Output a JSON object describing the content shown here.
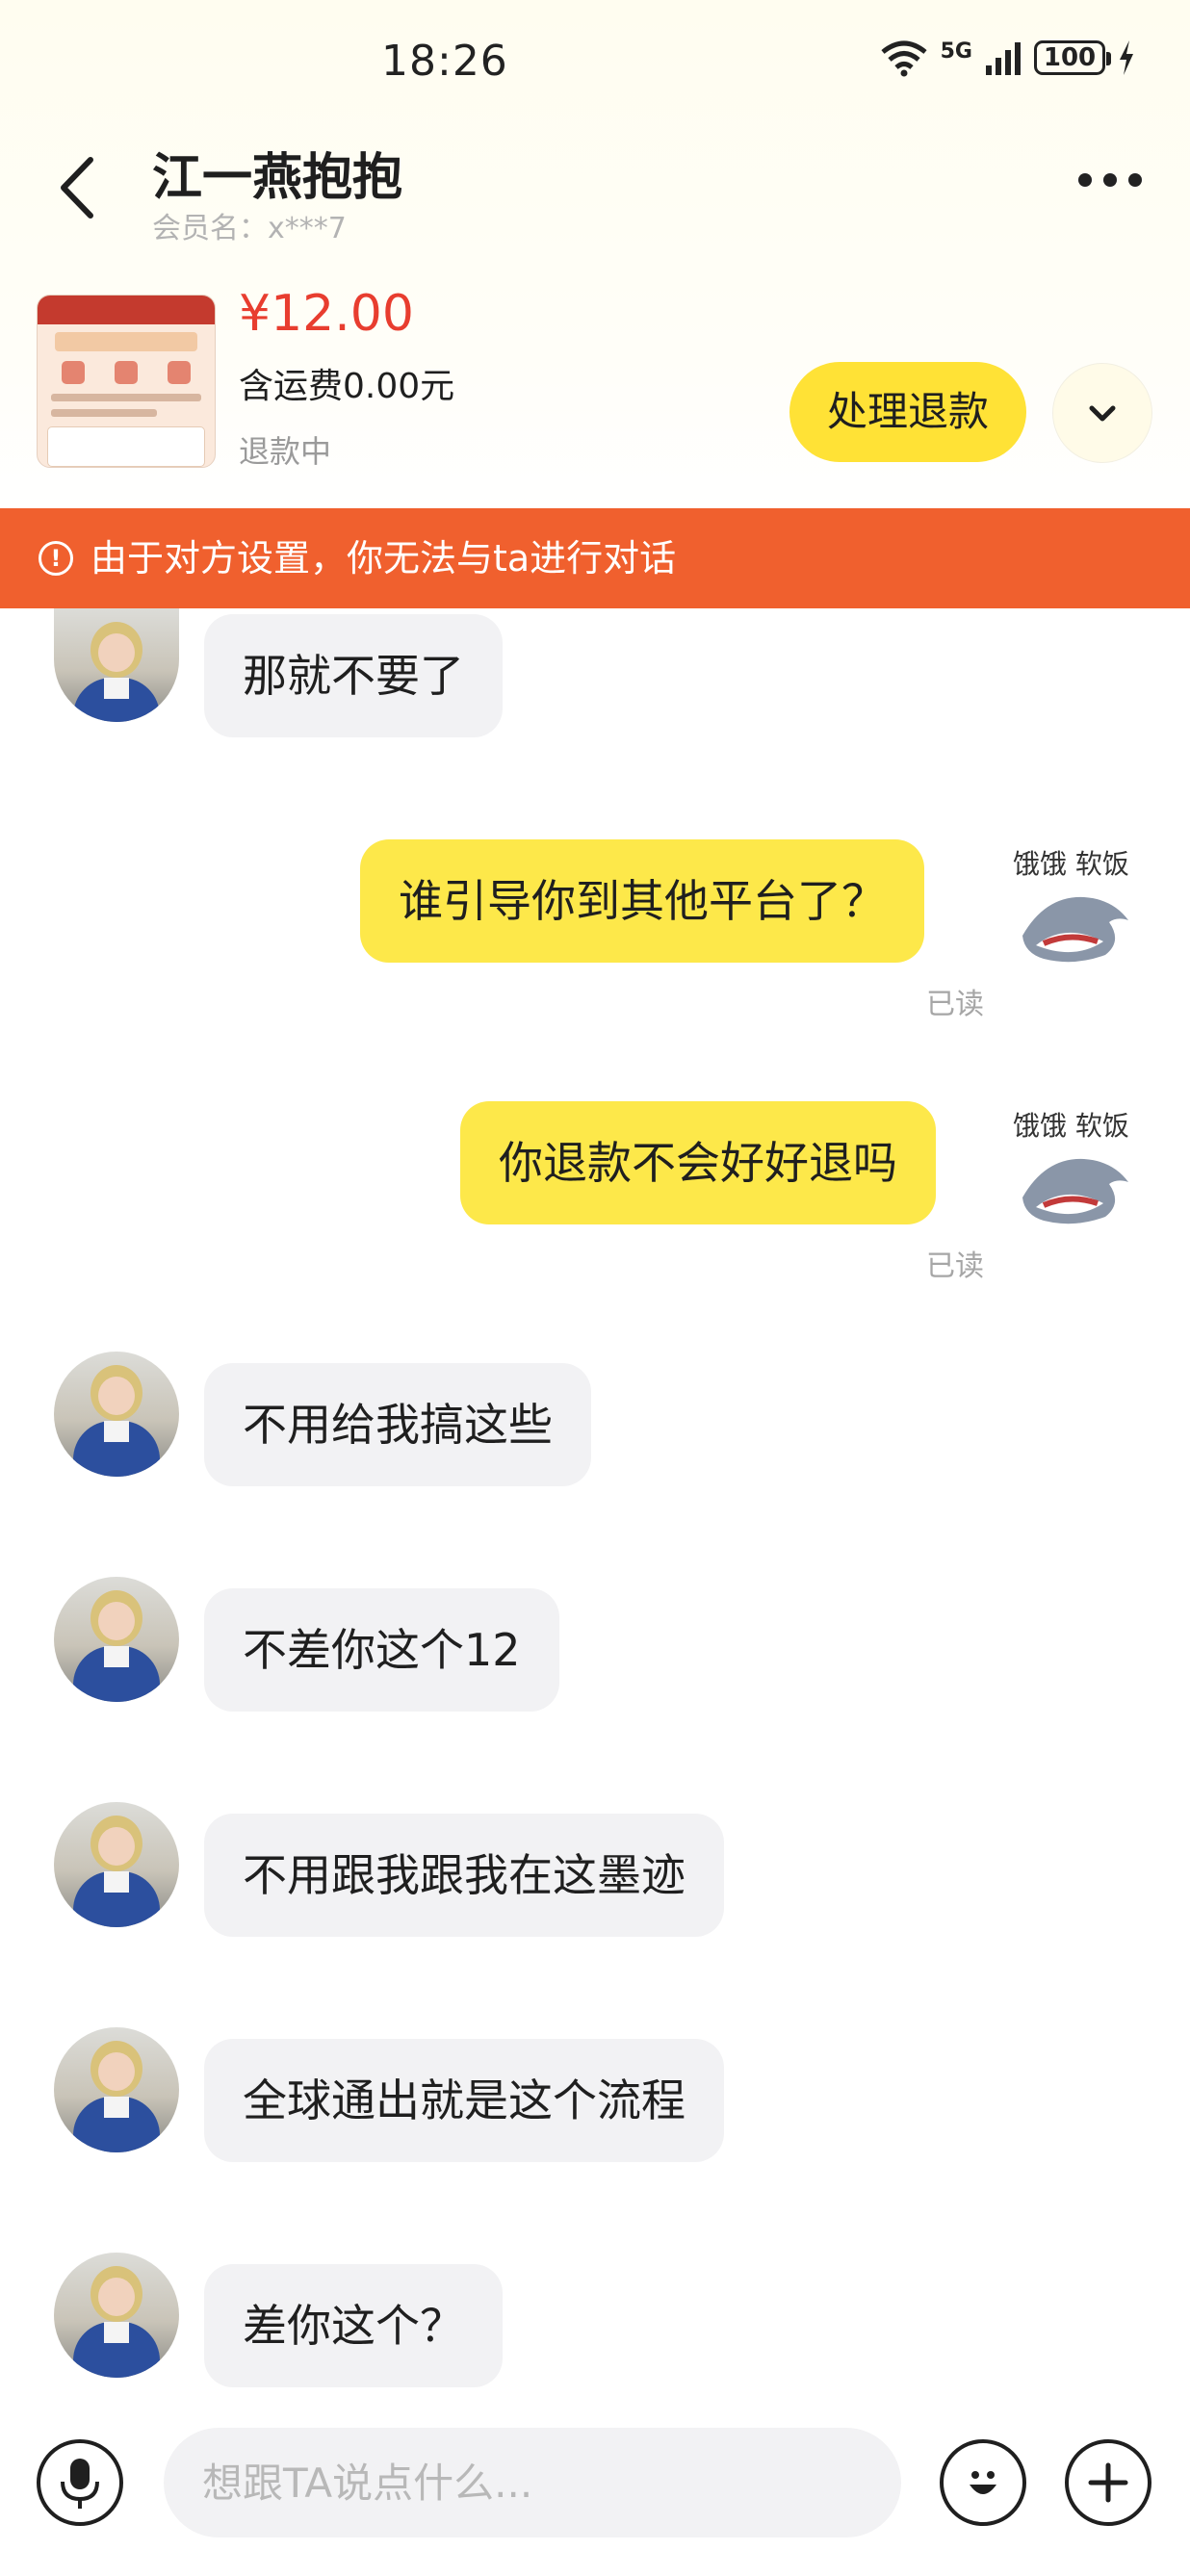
{
  "status_bar": {
    "time": "18:26",
    "network": "5G",
    "battery": "100"
  },
  "header": {
    "title": "江一燕抱抱",
    "member_label": "会员名：x***7"
  },
  "product": {
    "price": "¥12.00",
    "shipping": "含运费0.00元",
    "status": "退款中",
    "refund_button": "处理退款"
  },
  "banner": {
    "text": "由于对方设置，你无法与ta进行对话"
  },
  "messages": [
    {
      "side": "in",
      "text": "那就不要了"
    },
    {
      "side": "out",
      "text": "谁引导你到其他平台了？",
      "status": "已读",
      "sticker_caption": "饿饿 软饭"
    },
    {
      "side": "out",
      "text": "你退款不会好好退吗",
      "status": "已读",
      "sticker_caption": "饿饿 软饭"
    },
    {
      "side": "in",
      "text": "不用给我搞这些"
    },
    {
      "side": "in",
      "text": "不差你这个12"
    },
    {
      "side": "in",
      "text": "不用跟我跟我在这墨迹"
    },
    {
      "side": "in",
      "text": "全球通出就是这个流程"
    },
    {
      "side": "in",
      "text": "差你这个？"
    }
  ],
  "input": {
    "placeholder": "想跟TA说点什么..."
  },
  "icons": {
    "back": "chevron-left-icon",
    "more": "more-icon",
    "expand": "chevron-down-icon",
    "warning": "warning-icon",
    "mic": "microphone-icon",
    "emoji": "emoji-icon",
    "plus": "plus-icon"
  },
  "colors": {
    "accent_yellow": "#ffe236",
    "banner_orange": "#f0602e",
    "price_red": "#e83d2f"
  }
}
